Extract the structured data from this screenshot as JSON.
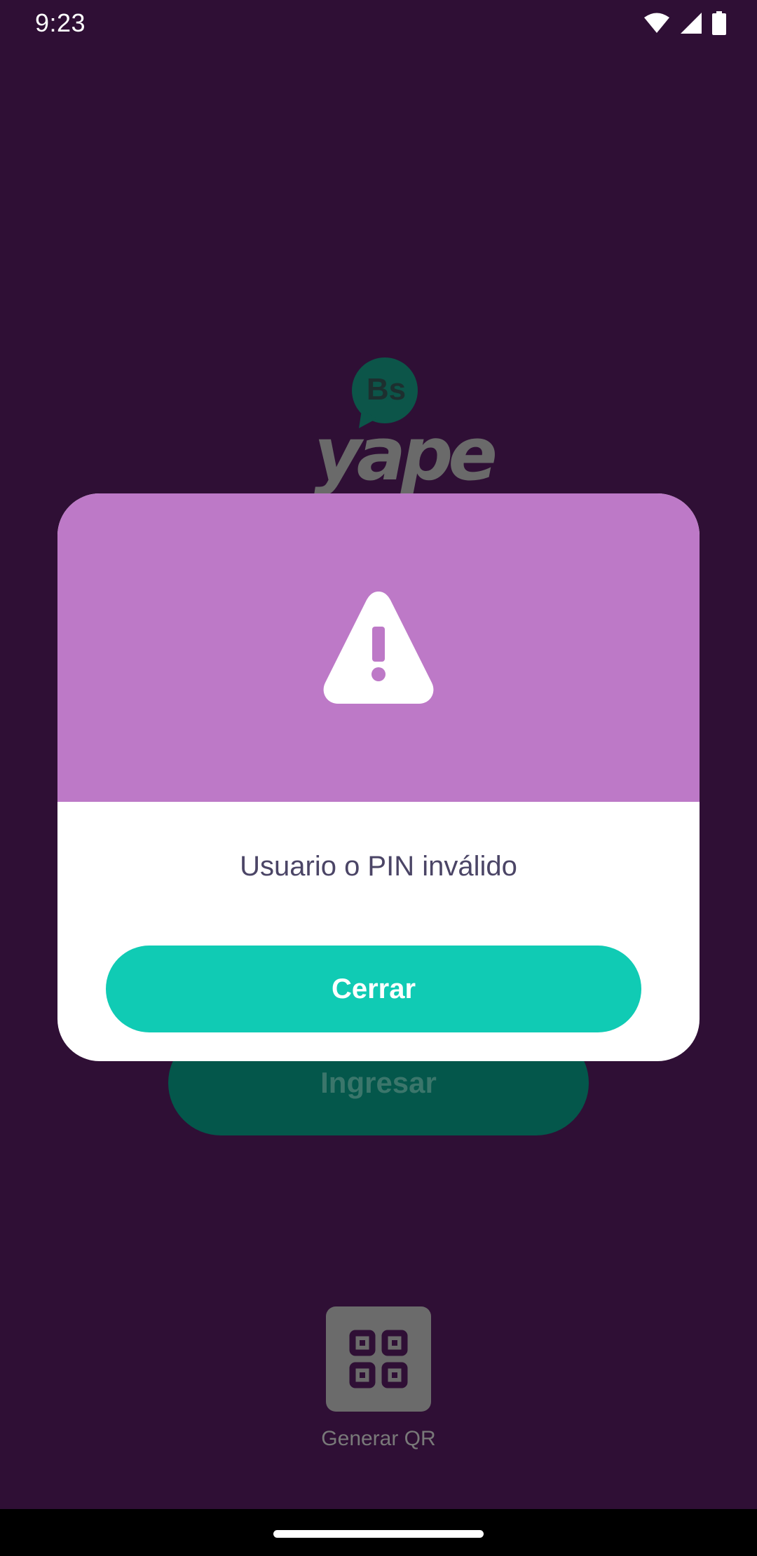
{
  "status_bar": {
    "time": "9:23",
    "icons": [
      "wifi-icon",
      "cell-signal-icon",
      "battery-icon"
    ]
  },
  "background": {
    "logo": {
      "badge_text": "Bs",
      "wordmark": "yape"
    },
    "login_button_label": "Ingresar",
    "generate_qr": {
      "icon": "qr-code-icon",
      "label": "Generar QR"
    }
  },
  "dialog": {
    "icon": "warning-icon",
    "message": "Usuario o PIN inválido",
    "close_button_label": "Cerrar"
  },
  "colors": {
    "background": "#2f0f35",
    "dialog_header": "#bd79c7",
    "primary_button": "#10cbb4",
    "message_text": "#4b4566",
    "dimmed_button": "#04574b"
  }
}
